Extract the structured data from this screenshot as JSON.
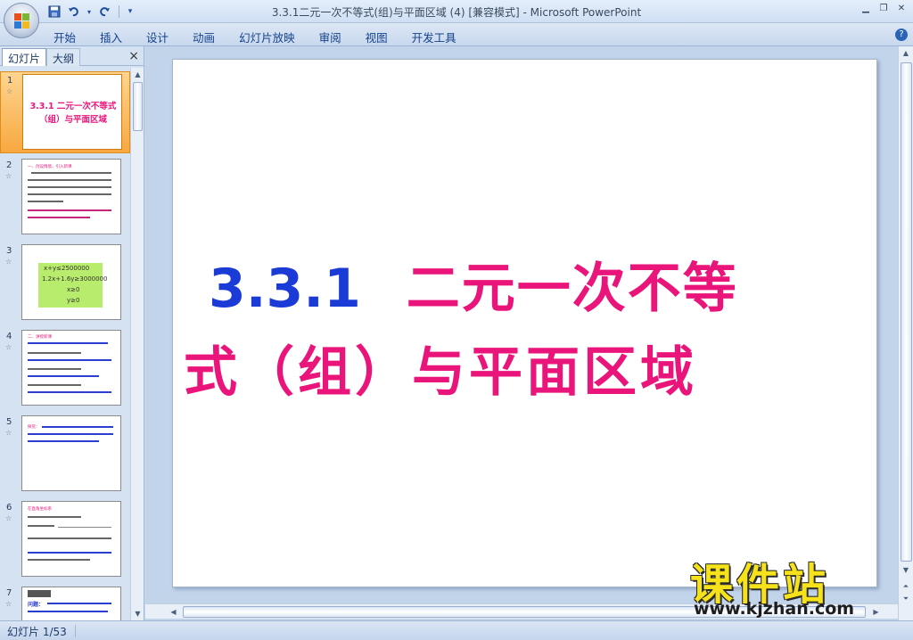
{
  "window": {
    "title": "3.3.1二元一次不等式(组)与平面区域 (4) [兼容模式] - Microsoft PowerPoint"
  },
  "quick_access": {
    "save_icon": "save-icon",
    "undo_icon": "undo-icon",
    "redo_icon": "redo-icon"
  },
  "ribbon": {
    "tabs": [
      "开始",
      "插入",
      "设计",
      "动画",
      "幻灯片放映",
      "审阅",
      "视图",
      "开发工具"
    ],
    "help": "?"
  },
  "left_pane": {
    "tab_slides": "幻灯片",
    "tab_outline": "大纲",
    "close": "×",
    "thumbnails": [
      {
        "num": "1",
        "selected": true,
        "title": "3.3.1 二元一次不等式（组）与平面区域"
      },
      {
        "num": "2",
        "selected": false,
        "heading": "一、创设情境，引入新课"
      },
      {
        "num": "3",
        "selected": false,
        "lines": [
          "x+y≤2500000",
          "1.2x+1.6y≥3000000",
          "x≥0",
          "y≥0"
        ]
      },
      {
        "num": "4",
        "selected": false,
        "heading": "二、讲授新课"
      },
      {
        "num": "5",
        "selected": false,
        "heading": "探究："
      },
      {
        "num": "6",
        "selected": false,
        "heading": "在直角坐标系"
      },
      {
        "num": "7",
        "selected": false,
        "heading": "问题："
      }
    ]
  },
  "slide": {
    "title_num": "3.3.1",
    "title_line1_cn": "二元一次不等",
    "title_line2": "式（组）与平面区域"
  },
  "watermark": {
    "cn": "课件站",
    "url": "www.kjzhan.com"
  },
  "status": {
    "slide_counter": "幻灯片 1/53"
  },
  "colors": {
    "title_number": "#1a3bd6",
    "title_chinese": "#ea157a",
    "selection": "#f7a840"
  }
}
